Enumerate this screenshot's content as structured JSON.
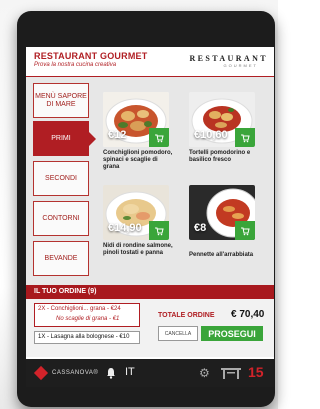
{
  "header": {
    "title": "RESTAURANT GOURMET",
    "subtitle": "Prova la nostra cucina creativa",
    "brand": "RESTAURANT",
    "brand_sub": "GOURMET"
  },
  "categories": [
    {
      "label": "MENÙ SAPORE DI MARE",
      "active": false
    },
    {
      "label": "PRIMI",
      "active": true
    },
    {
      "label": "SECONDI",
      "active": false
    },
    {
      "label": "CONTORNI",
      "active": false
    },
    {
      "label": "BEVANDE",
      "active": false
    }
  ],
  "dishes": [
    {
      "price": "€12",
      "name": "Conchiglioni pomodoro, spinaci e scaglie di grana"
    },
    {
      "price": "€10,60",
      "name": "Tortelli pomodorino e basilico fresco"
    },
    {
      "price": "€14,90",
      "name": "Nidi di rondine salmone, pinoli tostati e panna"
    },
    {
      "price": "€8",
      "name": "Pennette all'arrabbiata"
    }
  ],
  "order": {
    "title": "IL TUO ORDINE (9)",
    "item1_line1": "2X - Conchiglioni... grana - €24",
    "item1_line2": "No scaglie di grana - €1",
    "item2": "1X - Lasagna alla bolognese - €10",
    "total_label": "TOTALE ORDINE",
    "total_value": "€ 70,40",
    "cancel_label": "CANCELLA",
    "continue_label": "PROSEGUI"
  },
  "footer": {
    "brand": "CASSANOVA®",
    "language": "IT",
    "table_number": "15"
  },
  "colors": {
    "accent": "#b01e23",
    "green": "#3aa53a",
    "footer": "#1e1e1e"
  }
}
